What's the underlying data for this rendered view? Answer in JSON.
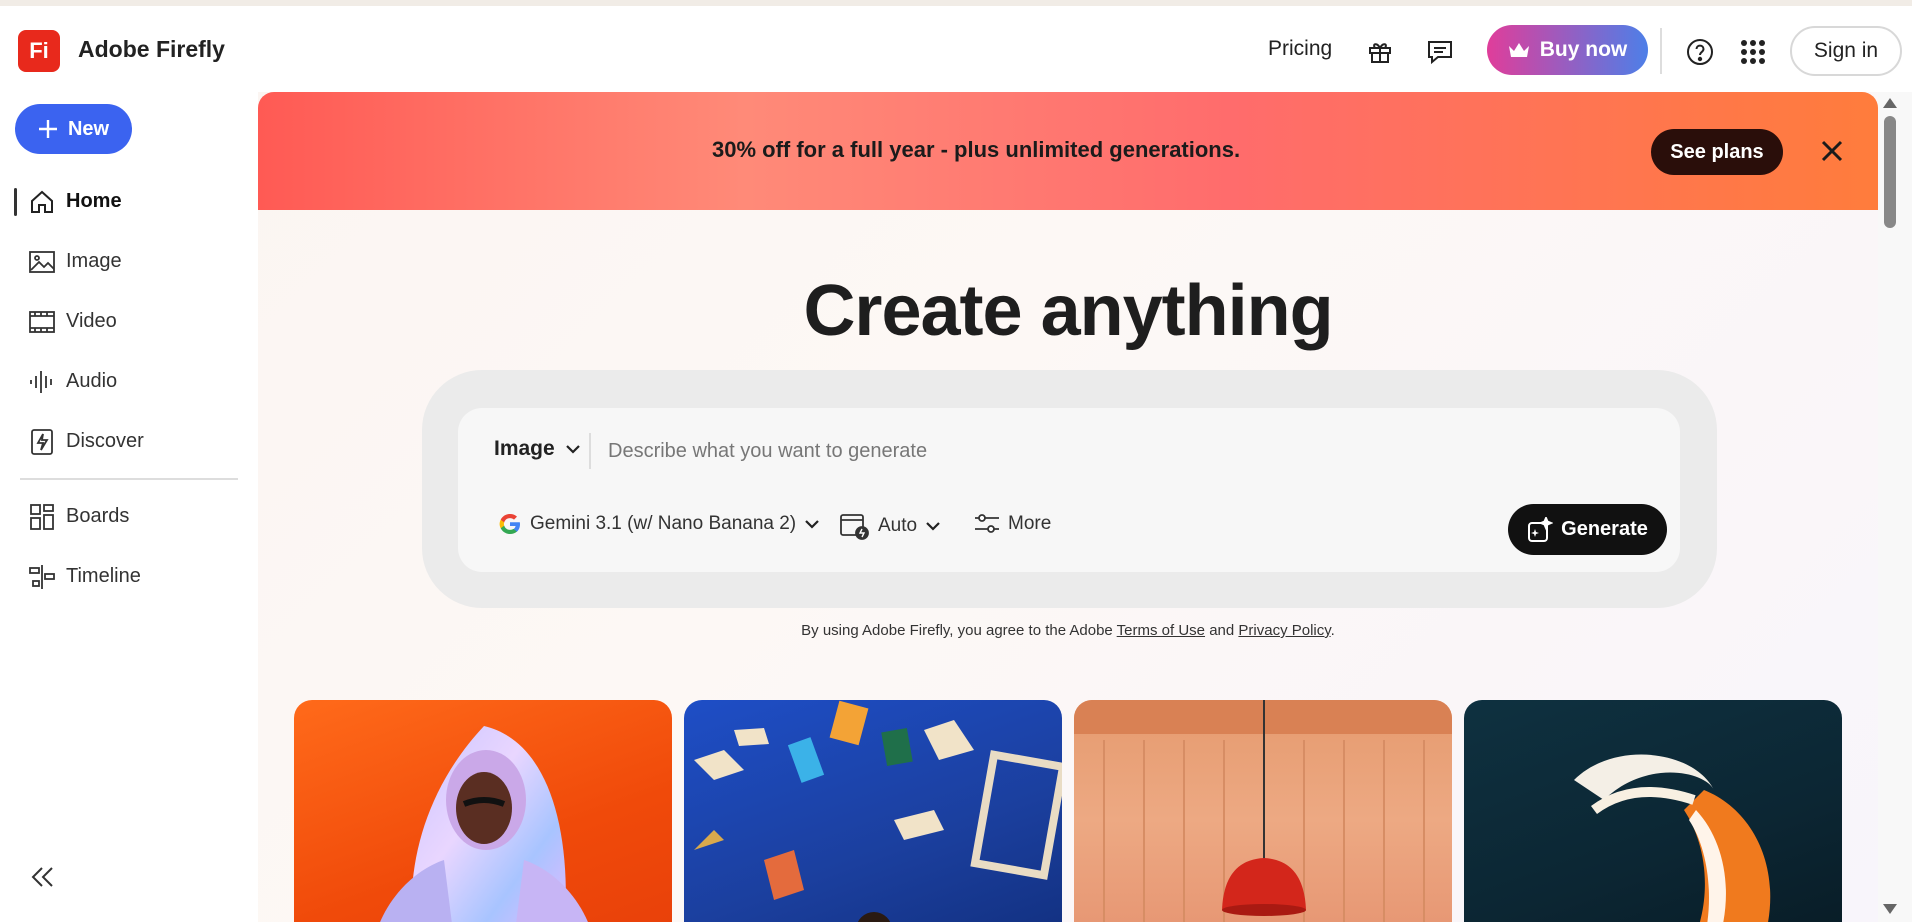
{
  "app": {
    "logo_text": "Fi",
    "name": "Adobe Firefly"
  },
  "header": {
    "pricing": "Pricing",
    "gift_icon": "gift-icon",
    "chat_icon": "chat-icon",
    "buy_now": "Buy now",
    "help_icon": "help-icon",
    "apps_icon": "apps-grid-icon",
    "sign_in": "Sign in",
    "buy_gradient": [
      "#e03d9a",
      "#4d7fe8"
    ]
  },
  "sidebar": {
    "new_label": "New",
    "items": [
      {
        "label": "Home",
        "icon": "home-icon",
        "active": true
      },
      {
        "label": "Image",
        "icon": "image-icon"
      },
      {
        "label": "Video",
        "icon": "video-icon"
      },
      {
        "label": "Audio",
        "icon": "audio-icon"
      },
      {
        "label": "Discover",
        "icon": "discover-icon"
      },
      {
        "label": "Boards",
        "icon": "boards-icon"
      },
      {
        "label": "Timeline",
        "icon": "timeline-icon"
      }
    ],
    "collapse_icon": "collapse-icon"
  },
  "banner": {
    "text": "30% off for a full year - plus unlimited generations.",
    "cta": "See plans",
    "close_icon": "close-icon"
  },
  "main": {
    "headline": "Create anything",
    "prompt": {
      "type_label": "Image",
      "placeholder": "Describe what you want to generate",
      "model": "Gemini 3.1 (w/ Nano Banana 2)",
      "aspect": "Auto",
      "more": "More",
      "generate": "Generate"
    },
    "terms": {
      "prefix": "By using Adobe Firefly, you agree to the Adobe ",
      "terms_link": "Terms of Use",
      "and": " and ",
      "privacy_link": "Privacy Policy",
      "suffix": "."
    }
  },
  "colors": {
    "accent": "#3b63f0",
    "brand_red": "#e8291c"
  }
}
